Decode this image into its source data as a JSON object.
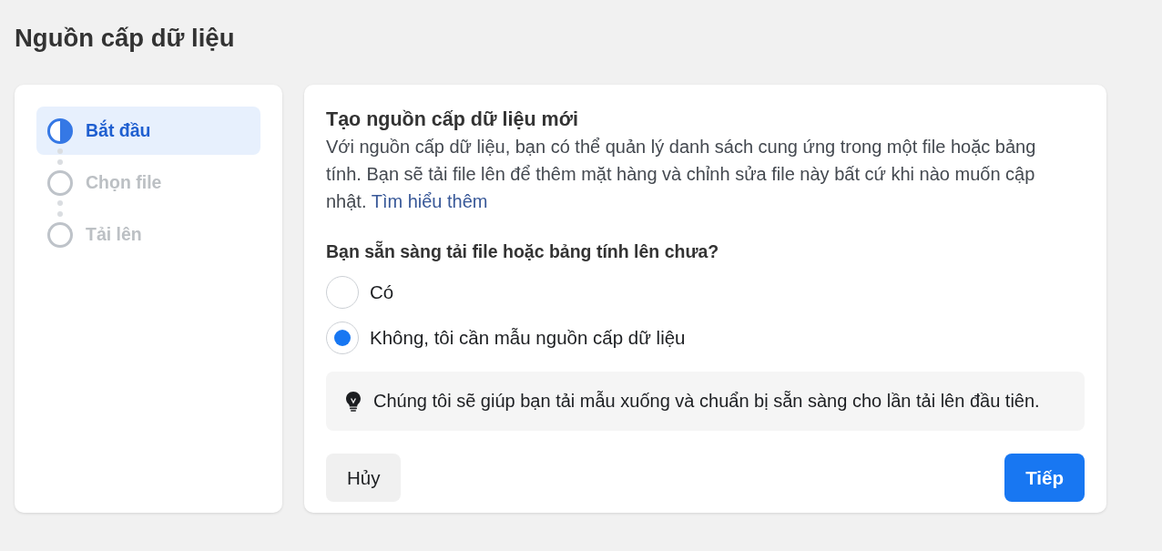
{
  "page": {
    "title": "Nguồn cấp dữ liệu"
  },
  "steps": [
    {
      "label": "Bắt đầu",
      "selected": true
    },
    {
      "label": "Chọn file",
      "selected": false
    },
    {
      "label": "Tải lên",
      "selected": false
    }
  ],
  "form": {
    "title": "Tạo nguồn cấp dữ liệu mới",
    "description": "Với nguồn cấp dữ liệu, bạn có thể quản lý danh sách cung ứng trong một file hoặc bảng tính. Bạn sẽ tải file lên để thêm mặt hàng và chỉnh sửa file này bất cứ khi nào muốn cập nhật.",
    "link": "Tìm hiểu thêm",
    "question": "Bạn sẵn sàng tải file hoặc bảng tính lên chưa?",
    "options": [
      {
        "label": "Có",
        "selected": false
      },
      {
        "label": "Không, tôi cần mẫu nguồn cấp dữ liệu",
        "selected": true
      }
    ],
    "tip": "Chúng tôi sẽ giúp bạn tải mẫu xuống và chuẩn bị sẵn sàng cho lần tải lên đầu tiên.",
    "buttons": [
      {
        "label": "Hủy",
        "kind": "secondary"
      },
      {
        "label": "Tiếp",
        "kind": "primary"
      }
    ]
  }
}
